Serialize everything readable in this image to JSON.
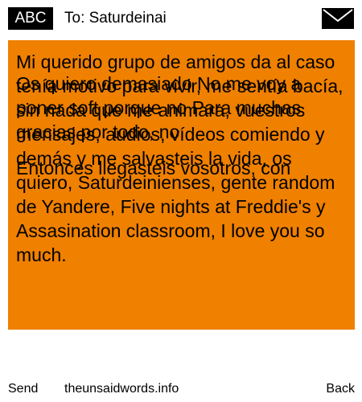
{
  "header": {
    "badge_label": "ABC",
    "to_line": "To: Saturdeinai",
    "mail_icon": "envelope-icon"
  },
  "message": {
    "accent_color": "#ef8000",
    "layer_1": "Mi querido grupo de amigos da al caso tenía motivo para vivir, me sentía bacía, sin nada que me animara, vuestros mensajes, audios, vídeos comiendo y demás y me salvasteis la vida, os quiero, Saturdeinienses, gente random de Yandere, Five nights at Freddie's y Assasination classroom, I love you so much.",
    "layer_2": "Os quiero demasiado No me voy a poner soft porque no Para muchas gracias por todo, no",
    "layer_3": "Entonces llegasteis vosotros, con"
  },
  "footer": {
    "send_label": "Send",
    "site_label": "theunsaidwords.info",
    "back_label": "Back"
  }
}
